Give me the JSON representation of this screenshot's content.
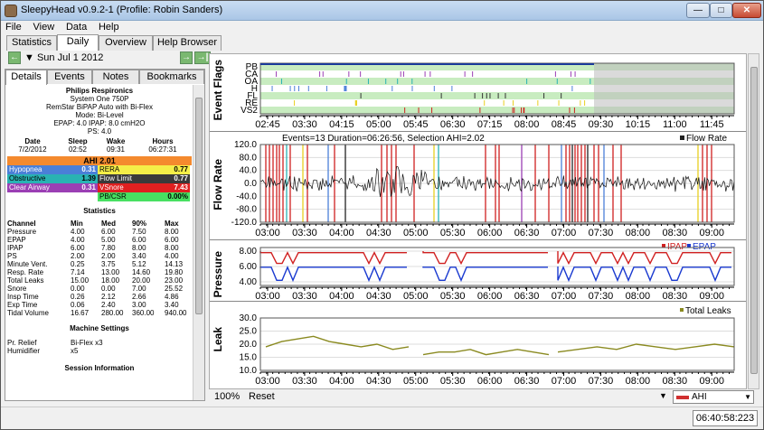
{
  "window": {
    "title": "SleepyHead v0.9.2-1   (Profile: Robin Sanders)",
    "minimize": "—",
    "maximize": "□",
    "close": "✕"
  },
  "menu": [
    "File",
    "View",
    "Data",
    "Help"
  ],
  "main_tabs": [
    "Statistics",
    "Daily",
    "Overview",
    "Help Browser"
  ],
  "active_main_tab": "Daily",
  "nav": {
    "prev": "←",
    "date": "▼ Sun Jul 1 2012",
    "next": "→",
    "last": "→|"
  },
  "sub_tabs": [
    "Details",
    "Events",
    "Notes",
    "Bookmarks"
  ],
  "active_sub_tab": "Details",
  "details": {
    "manufacturer": "Philips Respironics",
    "model": "System One 750P",
    "machine": "RemStar BiPAP Auto with Bi-Flex",
    "mode": "Mode: Bi-Level",
    "pressure": "EPAP: 4.0 IPAP: 8.0 cmH2O",
    "ps": "PS: 4.0",
    "session_headers": [
      "Date",
      "Sleep",
      "Wake",
      "Hours"
    ],
    "session_values": [
      "7/2/2012",
      "02:52",
      "09:31",
      "06:27:31"
    ],
    "ahi_label": "AHI 2.01",
    "indices": [
      {
        "name": "Hypopnea",
        "value": "0.31",
        "color": "#4a7fd8",
        "text": "#fff"
      },
      {
        "name": "RERA",
        "value": "0.77",
        "color": "#f4ee48",
        "text": "#000"
      },
      {
        "name": "Obstructive",
        "value": "1.39",
        "color": "#29b3b3",
        "text": "#000"
      },
      {
        "name": "Flow Limit",
        "value": "0.77",
        "color": "#3a3a3a",
        "text": "#fff"
      },
      {
        "name": "Clear Airway",
        "value": "0.31",
        "color": "#9b3fb4",
        "text": "#fff"
      },
      {
        "name": "VSnore",
        "value": "7.43",
        "color": "#e02020",
        "text": "#fff"
      },
      {
        "name": "",
        "value": "",
        "color": "#fff",
        "text": "#000"
      },
      {
        "name": "PB/CSR",
        "value": "0.00%",
        "color": "#48e062",
        "text": "#000"
      }
    ],
    "stats_title": "Statistics",
    "stats_headers": [
      "Channel",
      "Min",
      "Med",
      "90%",
      "Max"
    ],
    "stats_rows": [
      [
        "Pressure",
        "4.00",
        "6.00",
        "7.50",
        "8.00"
      ],
      [
        "EPAP",
        "4.00",
        "5.00",
        "6.00",
        "6.00"
      ],
      [
        "IPAP",
        "6.00",
        "7.80",
        "8.00",
        "8.00"
      ],
      [
        "PS",
        "2.00",
        "2.00",
        "3.40",
        "4.00"
      ],
      [
        "Minute Vent.",
        "0.25",
        "3.75",
        "5.12",
        "14.13"
      ],
      [
        "Resp. Rate",
        "7.14",
        "13.00",
        "14.60",
        "19.80"
      ],
      [
        "Total Leaks",
        "15.00",
        "18.00",
        "20.00",
        "23.00"
      ],
      [
        "Snore",
        "0.00",
        "0.00",
        "7.00",
        "25.52"
      ],
      [
        "Insp Time",
        "0.26",
        "2.12",
        "2.66",
        "4.86"
      ],
      [
        "Exp Time",
        "0.06",
        "2.40",
        "3.00",
        "3.40"
      ],
      [
        "Tidal Volume",
        "16.67",
        "280.00",
        "360.00",
        "940.00"
      ]
    ],
    "settings_title": "Machine Settings",
    "settings_rows": [
      [
        "Pr. Relief",
        "Bi-Flex x3"
      ],
      [
        "Humidifier",
        "x5"
      ]
    ],
    "session_info_title": "Session Information"
  },
  "graphs": {
    "time_ticks_flags": [
      "02:45",
      "03:30",
      "04:15",
      "05:00",
      "05:45",
      "06:30",
      "07:15",
      "08:00",
      "08:45",
      "09:30",
      "10:15",
      "11:00",
      "11:45"
    ],
    "time_ticks": [
      "03:00",
      "03:30",
      "04:00",
      "04:30",
      "05:00",
      "05:30",
      "06:00",
      "06:30",
      "07:00",
      "07:30",
      "08:00",
      "08:30",
      "09:00"
    ],
    "event_flags": {
      "label": "Event Flags",
      "rows": [
        "PB",
        "CA",
        "OA",
        "H",
        "FL",
        "RE",
        "VS2"
      ]
    },
    "flow_rate": {
      "label": "Flow Rate",
      "header": "Events=13 Duration=06:26:56, Selection AHI=2.02",
      "legend": "Flow Rate",
      "y_ticks": [
        "120.0",
        "80.0",
        "40.0",
        "0.0",
        "-40.0",
        "-80.0",
        "-120.0"
      ]
    },
    "pressure": {
      "label": "Pressure",
      "legend_ipap": "IPAP",
      "legend_epap": "EPAP",
      "y_ticks": [
        "8.00",
        "6.00",
        "4.00"
      ],
      "ipap_color": "#d02020",
      "epap_color": "#1a3ad0"
    },
    "leak": {
      "label": "Leak",
      "legend": "Total Leaks",
      "y_ticks": [
        "30.0",
        "25.0",
        "20.0",
        "15.0",
        "10.0"
      ],
      "color": "#8a8a20"
    }
  },
  "bottom": {
    "zoom": "100%",
    "reset": "Reset",
    "combo_value": "AHI",
    "combo_arrow": "▼",
    "dropdown": "▼"
  },
  "status": {
    "clock": "06:40:58:223"
  }
}
